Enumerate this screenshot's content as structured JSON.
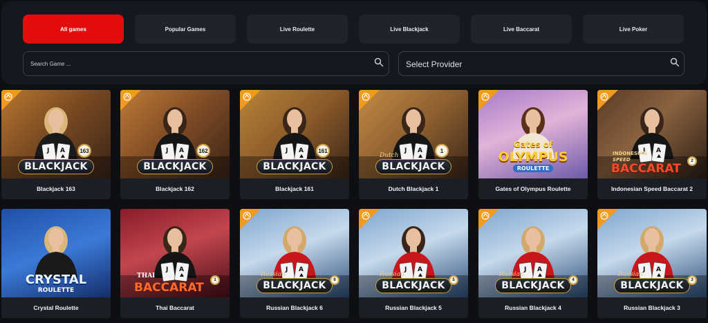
{
  "tabs": [
    {
      "label": "All games",
      "active": true
    },
    {
      "label": "Popular Games",
      "active": false
    },
    {
      "label": "Live Roulette",
      "active": false
    },
    {
      "label": "Live Blackjack",
      "active": false
    },
    {
      "label": "Live Baccarat",
      "active": false
    },
    {
      "label": "Live Poker",
      "active": false
    }
  ],
  "search": {
    "placeholder": "Search Game ..."
  },
  "provider": {
    "label": "Select Provider"
  },
  "colors": {
    "accent": "#e40c0c",
    "corner": "#f29a1d",
    "panel": "#15181e",
    "card": "#1b1e25"
  },
  "games": [
    {
      "name": "Blackjack 163",
      "logo": "BLACKJACK",
      "badge": "163"
    },
    {
      "name": "Blackjack 162",
      "logo": "BLACKJACK",
      "badge": "162"
    },
    {
      "name": "Blackjack 161",
      "logo": "BLACKJACK",
      "badge": "161"
    },
    {
      "name": "Dutch Blackjack 1",
      "logo": "BLACKJACK",
      "script": "Dutch",
      "badge": "1"
    },
    {
      "name": "Gates of Olympus Roulette",
      "logo_top": "Gates of",
      "logo": "OLYMPUS",
      "logo_sub": "ROULETTE"
    },
    {
      "name": "Indonesian Speed Baccarat 2",
      "logo_top": "INDONESIAN",
      "logo_mid": "SPEED",
      "logo": "BACCARAT",
      "badge": "2"
    },
    {
      "name": "Crystal Roulette",
      "logo": "CRYSTAL",
      "logo_sub": "ROULETTE"
    },
    {
      "name": "Thai Baccarat",
      "script": "THAI",
      "logo": "BACCARAT",
      "badge": "1"
    },
    {
      "name": "Russian Blackjack 6",
      "script": "Russian",
      "logo": "BLACKJACK",
      "badge": "6"
    },
    {
      "name": "Russian Blackjack 5",
      "script": "Russian",
      "logo": "BLACKJACK",
      "badge": "5"
    },
    {
      "name": "Russian Blackjack 4",
      "script": "Russian",
      "logo": "BLACKJACK",
      "badge": "4"
    },
    {
      "name": "Russian Blackjack 3",
      "script": "Russian",
      "logo": "BLACKJACK",
      "badge": "3"
    }
  ]
}
